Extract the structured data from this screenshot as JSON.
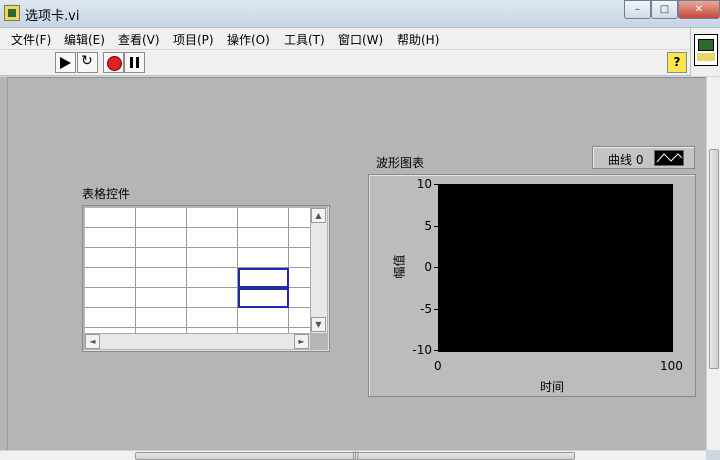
{
  "window": {
    "title": "选项卡.vi",
    "minimize_glyph": "–",
    "maximize_glyph": "□",
    "close_glyph": "✕"
  },
  "menu": {
    "items": [
      {
        "label": "文件(F)"
      },
      {
        "label": "编辑(E)"
      },
      {
        "label": "查看(V)"
      },
      {
        "label": "项目(P)"
      },
      {
        "label": "操作(O)"
      },
      {
        "label": "工具(T)"
      },
      {
        "label": "窗口(W)"
      },
      {
        "label": "帮助(H)"
      }
    ]
  },
  "toolbar": {
    "buttons": [
      "run-arrow-icon",
      "run-continuously-icon",
      "abort-icon",
      "pause-icon"
    ],
    "help_label": "?"
  },
  "table_control": {
    "label": "表格控件",
    "rows": 6,
    "columns": 5,
    "selected_cells": [
      [
        3,
        3
      ],
      [
        4,
        3
      ]
    ]
  },
  "waveform_chart": {
    "label": "波形图表",
    "legend_label": "曲线 0",
    "x_axis_label": "时间",
    "y_axis_label": "幅值",
    "x_ticks": [
      "0",
      "100"
    ],
    "y_ticks": [
      "10",
      "5",
      "0",
      "-5",
      "-10"
    ]
  },
  "chart_data": {
    "type": "line",
    "title": "波形图表",
    "xlabel": "时间",
    "ylabel": "幅值",
    "xlim": [
      0,
      100
    ],
    "ylim": [
      -10,
      10
    ],
    "series": [
      {
        "name": "曲线 0",
        "x": [],
        "y": []
      }
    ],
    "grid": false,
    "legend": "top-right"
  },
  "scrollbar": {
    "grip": "|||",
    "up_arrow": "▲",
    "down_arrow": "▼",
    "left_arrow": "◄",
    "right_arrow": "►"
  }
}
